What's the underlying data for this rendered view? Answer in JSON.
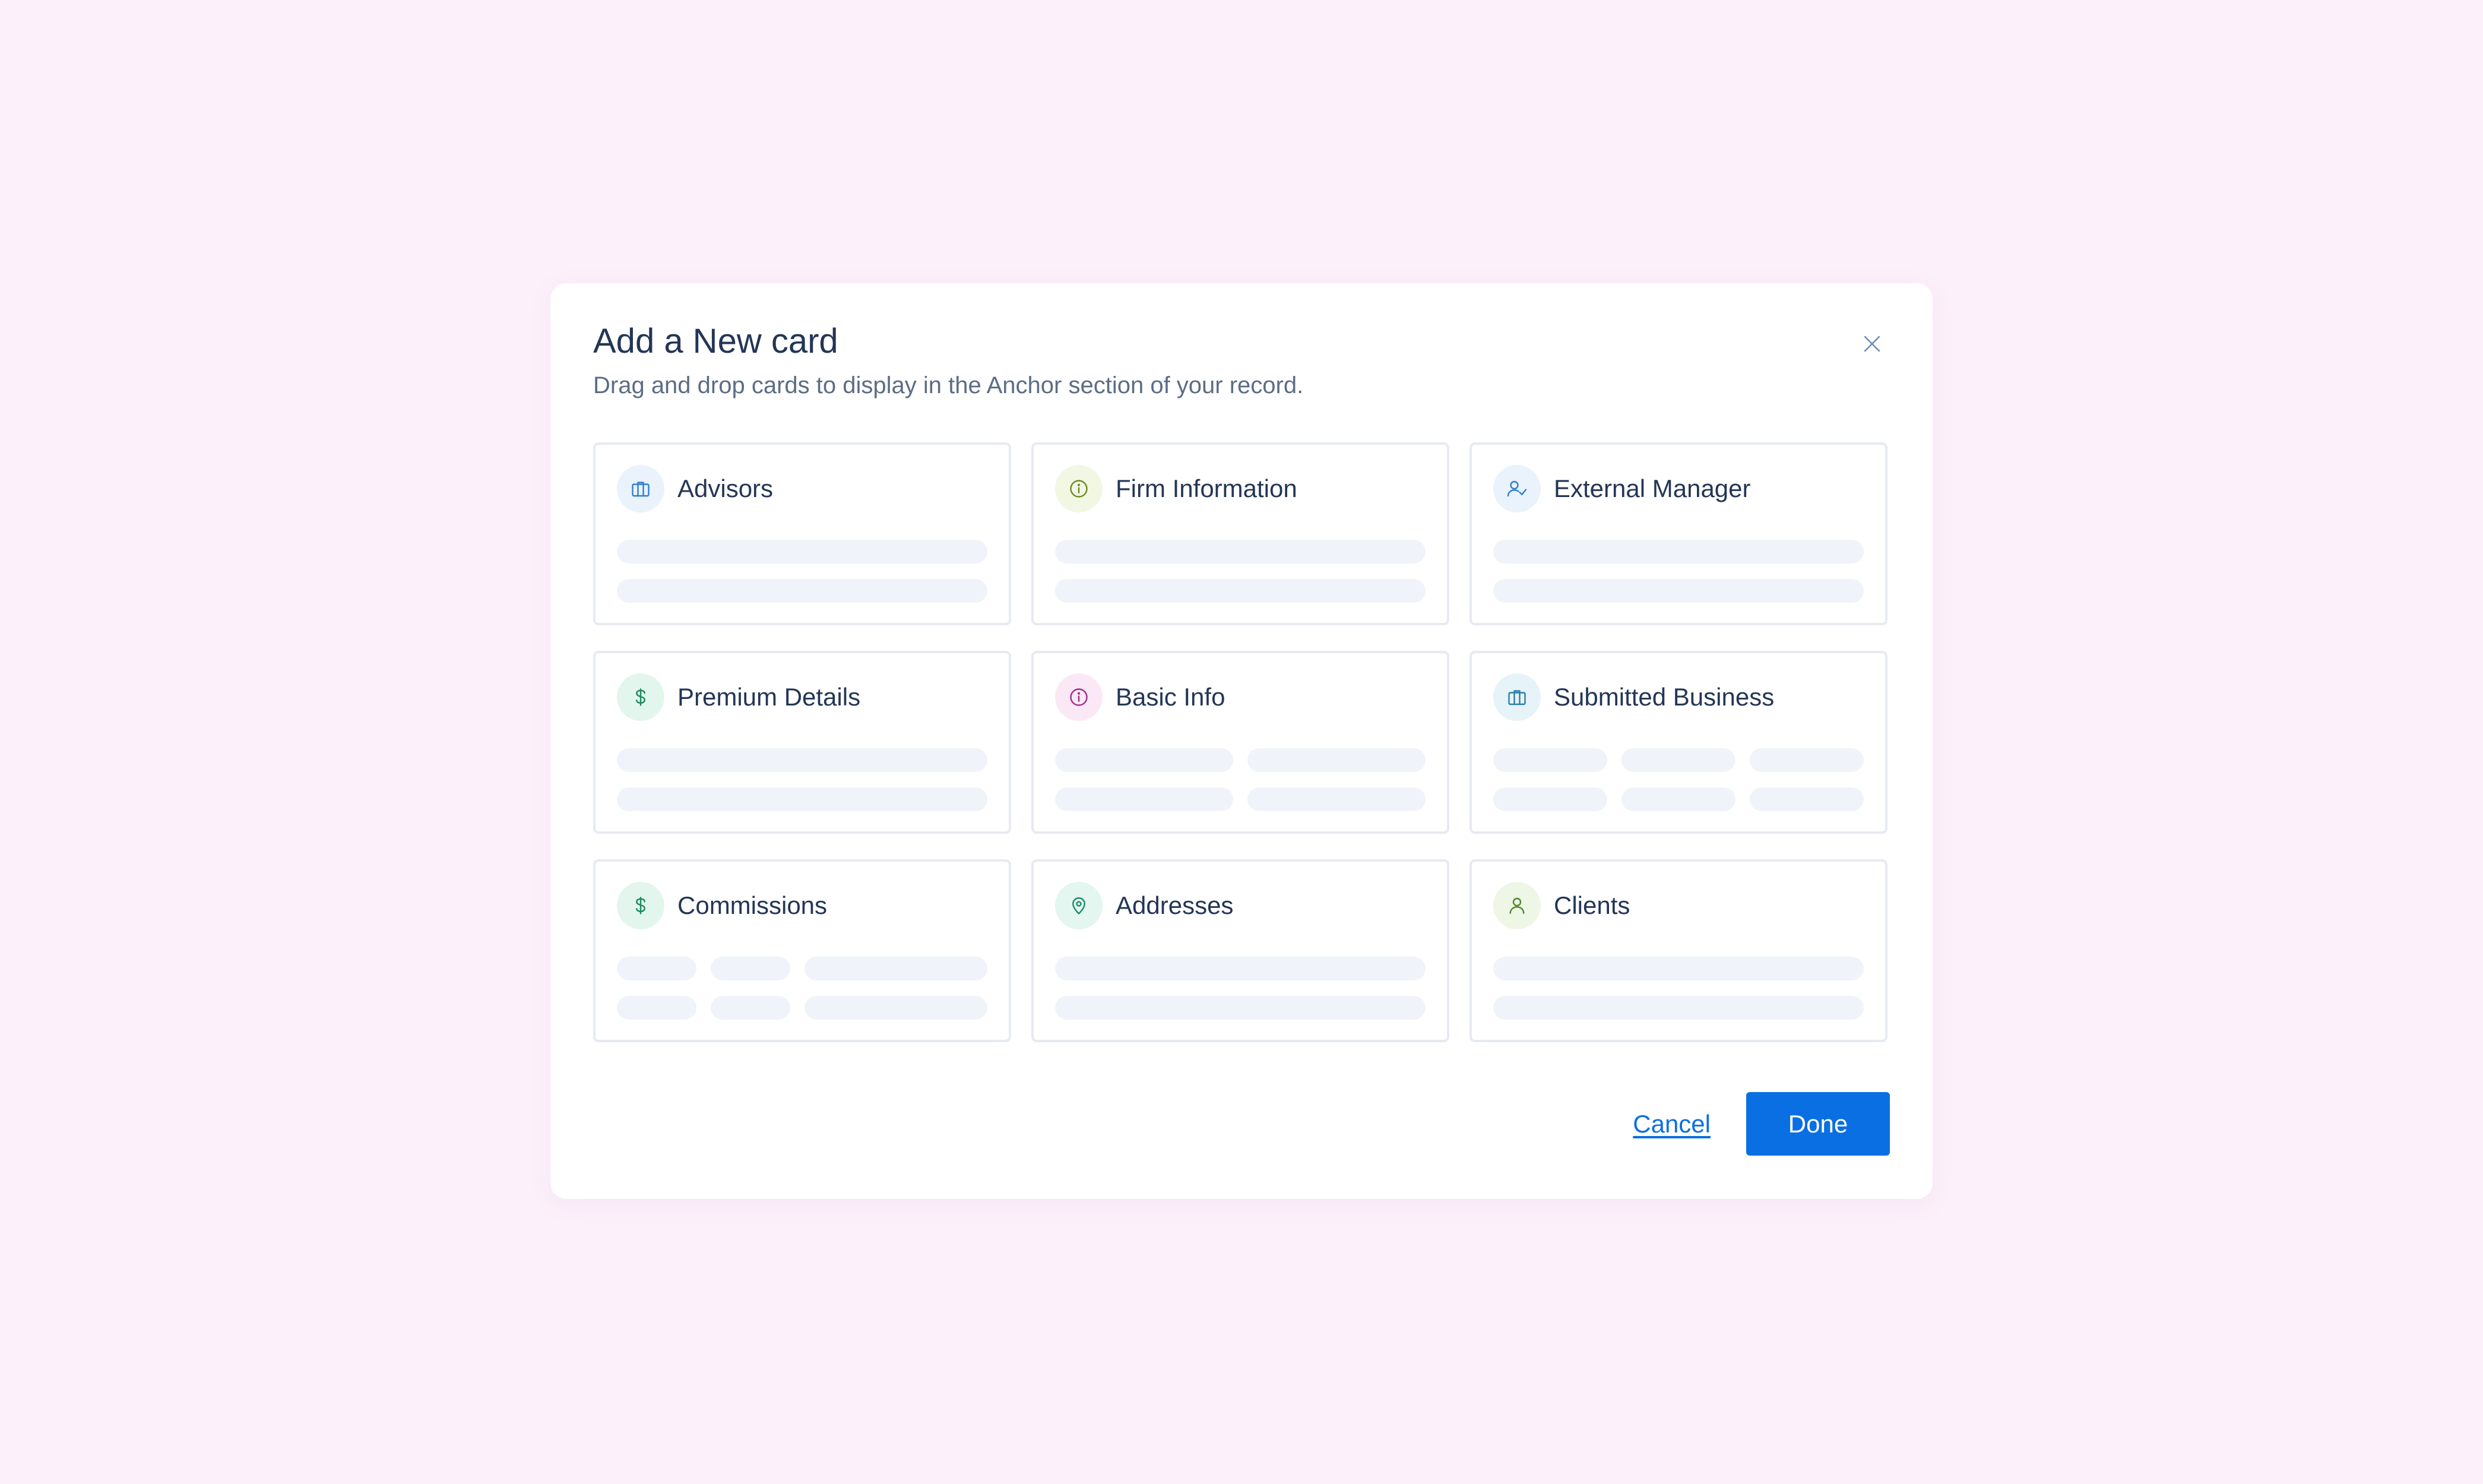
{
  "modal": {
    "title": "Add a New card",
    "subtitle": "Drag and drop cards to display in the Anchor section of your record.",
    "close_icon": "close-icon"
  },
  "cards": [
    {
      "key": "advisors",
      "label": "Advisors",
      "icon": "briefcase-icon",
      "icon_color": "#2f7fd0",
      "icon_bg": "#eaf2fc",
      "skeleton_columns": 1
    },
    {
      "key": "firm-information",
      "label": "Firm Information",
      "icon": "info-icon",
      "icon_color": "#6b8a1f",
      "icon_bg": "#f2f7e4",
      "skeleton_columns": 1
    },
    {
      "key": "external-manager",
      "label": "External Manager",
      "icon": "user-check-icon",
      "icon_color": "#2f7fd0",
      "icon_bg": "#eaf2fc",
      "skeleton_columns": 1
    },
    {
      "key": "premium-details",
      "label": "Premium Details",
      "icon": "dollar-icon",
      "icon_color": "#1d8a5c",
      "icon_bg": "#e3f6ee",
      "skeleton_columns": 1
    },
    {
      "key": "basic-info",
      "label": "Basic Info",
      "icon": "info-icon",
      "icon_color": "#a02b8e",
      "icon_bg": "#fbe8f6",
      "skeleton_columns": 2
    },
    {
      "key": "submitted-business",
      "label": "Submitted Business",
      "icon": "briefcase-icon",
      "icon_color": "#2a7fa6",
      "icon_bg": "#e6f3f9",
      "skeleton_columns": 3
    },
    {
      "key": "commissions",
      "label": "Commissions",
      "icon": "dollar-icon",
      "icon_color": "#1d8a5c",
      "icon_bg": "#e3f6ee",
      "skeleton_columns": "commissions"
    },
    {
      "key": "addresses",
      "label": "Addresses",
      "icon": "map-pin-icon",
      "icon_color": "#1d8a6c",
      "icon_bg": "#e3f6f0",
      "skeleton_columns": 1
    },
    {
      "key": "clients",
      "label": "Clients",
      "icon": "user-icon",
      "icon_color": "#4f8a2b",
      "icon_bg": "#eef6e6",
      "skeleton_columns": 1
    }
  ],
  "footer": {
    "cancel_label": "Cancel",
    "done_label": "Done"
  },
  "colors": {
    "page_background": "#fcf0fa",
    "primary": "#0a6fe3",
    "skeleton": "#f0f3fa",
    "card_border": "#e7eaf1",
    "title_text": "#243656"
  }
}
